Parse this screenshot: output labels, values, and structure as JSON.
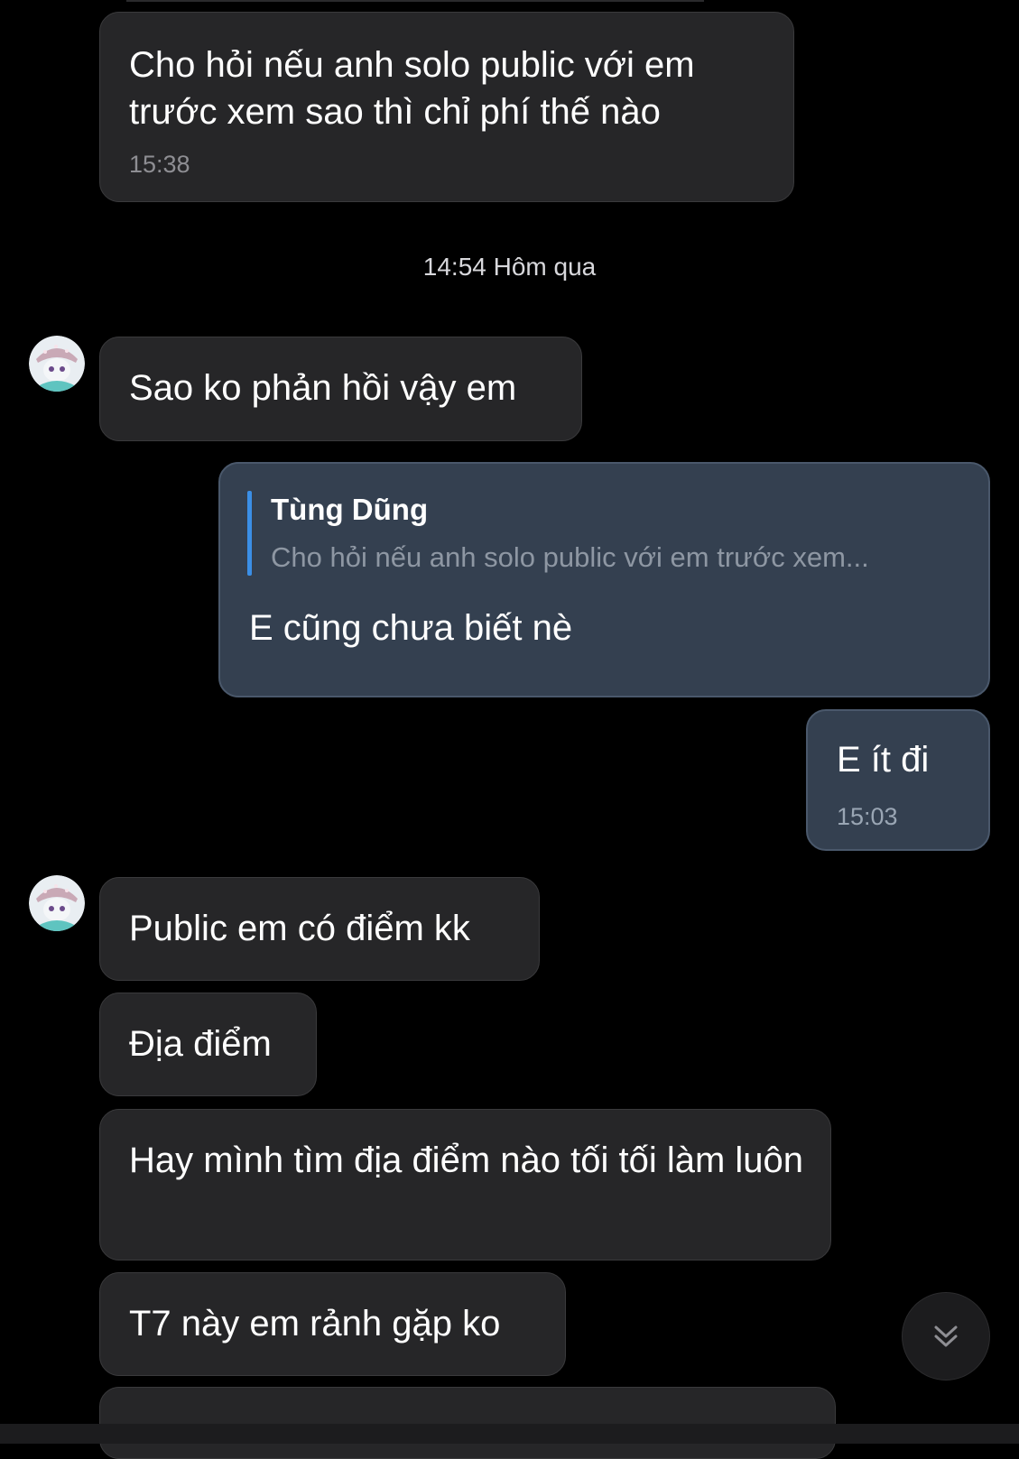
{
  "date_separator": "14:54 Hôm qua",
  "messages": [
    {
      "direction": "incoming",
      "text_lines": [
        "Cho hỏi nếu anh solo public với em",
        "trước xem sao thì chỉ phí thế nào"
      ],
      "time": "15:38"
    },
    {
      "direction": "incoming",
      "text": "Sao ko phản hồi vậy em",
      "avatar": "cartoon-avatar"
    },
    {
      "direction": "outgoing",
      "reply_to": {
        "name": "Tùng Dũng",
        "snippet": "Cho hỏi nếu anh solo public với em trước xem..."
      },
      "text": "E cũng chưa biết nè"
    },
    {
      "direction": "outgoing",
      "text": "E ít đi",
      "time": "15:03"
    },
    {
      "direction": "incoming",
      "text": "Public em có điểm kk",
      "avatar": "cartoon-avatar"
    },
    {
      "direction": "incoming",
      "text": "Địa điểm"
    },
    {
      "direction": "incoming",
      "text": "Hay mình tìm địa điểm nào tối tối làm luôn"
    },
    {
      "direction": "incoming",
      "text": "T7 này em rảnh gặp ko"
    }
  ],
  "icons": {
    "scroll_down": "double-chevron-down-icon",
    "avatar": "avatar"
  },
  "colors": {
    "background": "#000000",
    "incoming_bubble": "#262628",
    "outgoing_bubble": "#344050",
    "reply_accent": "#3b8fe6",
    "timestamp": "#8e8e93"
  }
}
